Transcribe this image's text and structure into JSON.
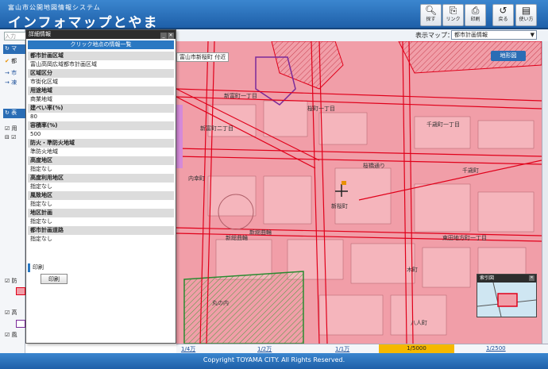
{
  "header": {
    "subtitle": "富山市公開地図情報システム",
    "title": "インフォマップとやま",
    "buttons": [
      {
        "label": "探す",
        "icon": "search-icon"
      },
      {
        "label": "リンク",
        "icon": "link-icon"
      },
      {
        "label": "印刷",
        "icon": "printer-icon"
      },
      {
        "label": "戻る",
        "icon": "undo-icon"
      },
      {
        "label": "使い方",
        "icon": "help-icon"
      }
    ]
  },
  "toolbar": {
    "map_label": "表示マップ：",
    "map_value": "都市計画情報"
  },
  "sidebar": {
    "input_placeholder": "入力",
    "bar1": "マ",
    "bar2": "表",
    "check1": "都",
    "row1": "市",
    "row2": "凍",
    "check2": "用",
    "check3": "防",
    "check4": "高",
    "check5": "風"
  },
  "panel": {
    "window_title": "詳細情報",
    "heading": "クリック地点の情報一覧",
    "items": [
      {
        "label": "都市計画区域",
        "value": "富山高岡広域都市計画区域"
      },
      {
        "label": "区域区分",
        "value": "市街化区域"
      },
      {
        "label": "用途地域",
        "value": "商業地域"
      },
      {
        "label": "建ぺい率(%)",
        "value": "80"
      },
      {
        "label": "容積率(%)",
        "value": "500"
      },
      {
        "label": "防火・準防火地域",
        "value": "準防火地域"
      },
      {
        "label": "高度地区",
        "value": "指定なし"
      },
      {
        "label": "高度利用地区",
        "value": "指定なし"
      },
      {
        "label": "風致地区",
        "value": "指定なし"
      },
      {
        "label": "地区計画",
        "value": "指定なし"
      },
      {
        "label": "都市計画道路",
        "value": "指定なし"
      }
    ],
    "print_section": "印刷",
    "print_button": "印刷"
  },
  "map": {
    "address": "富山市新桜町 付近",
    "terrain_button": "地形図",
    "labels": [
      {
        "text": "新富町一丁目"
      },
      {
        "text": "桜町一丁目"
      },
      {
        "text": "新富町二丁目"
      },
      {
        "text": "千歳町一丁目"
      },
      {
        "text": "内幸町"
      },
      {
        "text": "桜橋通り"
      },
      {
        "text": "千歳町"
      },
      {
        "text": "新桜町"
      },
      {
        "text": "新総曲輪"
      },
      {
        "text": "新総曲輪"
      },
      {
        "text": "東田地方町一丁目"
      },
      {
        "text": "丸の内"
      },
      {
        "text": "木町"
      },
      {
        "text": "八人町"
      }
    ],
    "index_title": "索引図"
  },
  "scalebar": {
    "items": [
      "1/4万",
      "1/2万",
      "1/1万",
      "1/5000",
      "1/2500"
    ],
    "active": "1/5000"
  },
  "footer": {
    "copyright": "Copyright TOYAMA CITY.  All Rights Reserved."
  },
  "colors": {
    "header_blue": "#2a6db5",
    "zone_commercial": "#f19ea8",
    "road_red": "#e0001a",
    "active_scale": "#f5b800"
  }
}
